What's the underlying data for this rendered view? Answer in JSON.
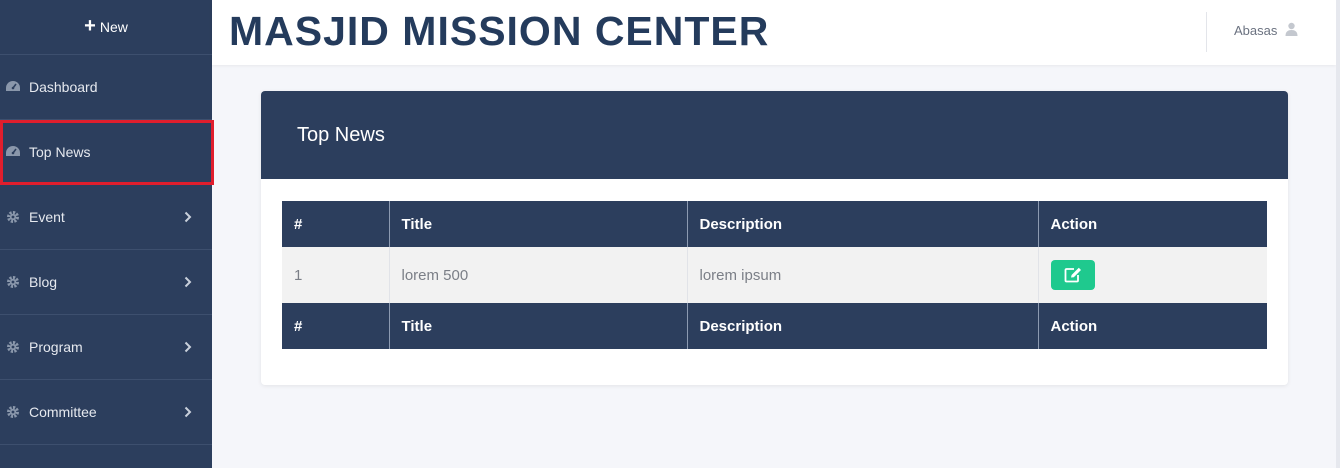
{
  "sidebar": {
    "new_label": "New",
    "items": [
      {
        "label": "Dashboard",
        "icon": "dashboard-icon",
        "has_chevron": false
      },
      {
        "label": "Top News",
        "icon": "dashboard-icon",
        "has_chevron": false,
        "active": true
      },
      {
        "label": "Event",
        "icon": "gear-icon",
        "has_chevron": true
      },
      {
        "label": "Blog",
        "icon": "gear-icon",
        "has_chevron": true
      },
      {
        "label": "Program",
        "icon": "gear-icon",
        "has_chevron": true
      },
      {
        "label": "Committee",
        "icon": "gear-icon",
        "has_chevron": true
      }
    ]
  },
  "header": {
    "brand": "MASJID MISSION CENTER",
    "user_name": "Abasas"
  },
  "card": {
    "title": "Top News",
    "columns": [
      "#",
      "Title",
      "Description",
      "Action"
    ],
    "rows": [
      {
        "num": "1",
        "title": "lorem 500",
        "description": "lorem ipsum"
      }
    ]
  },
  "colors": {
    "sidebar_bg": "#2c3e5d",
    "active_outline": "#e01e2d",
    "edit_button": "#1fc98e"
  }
}
